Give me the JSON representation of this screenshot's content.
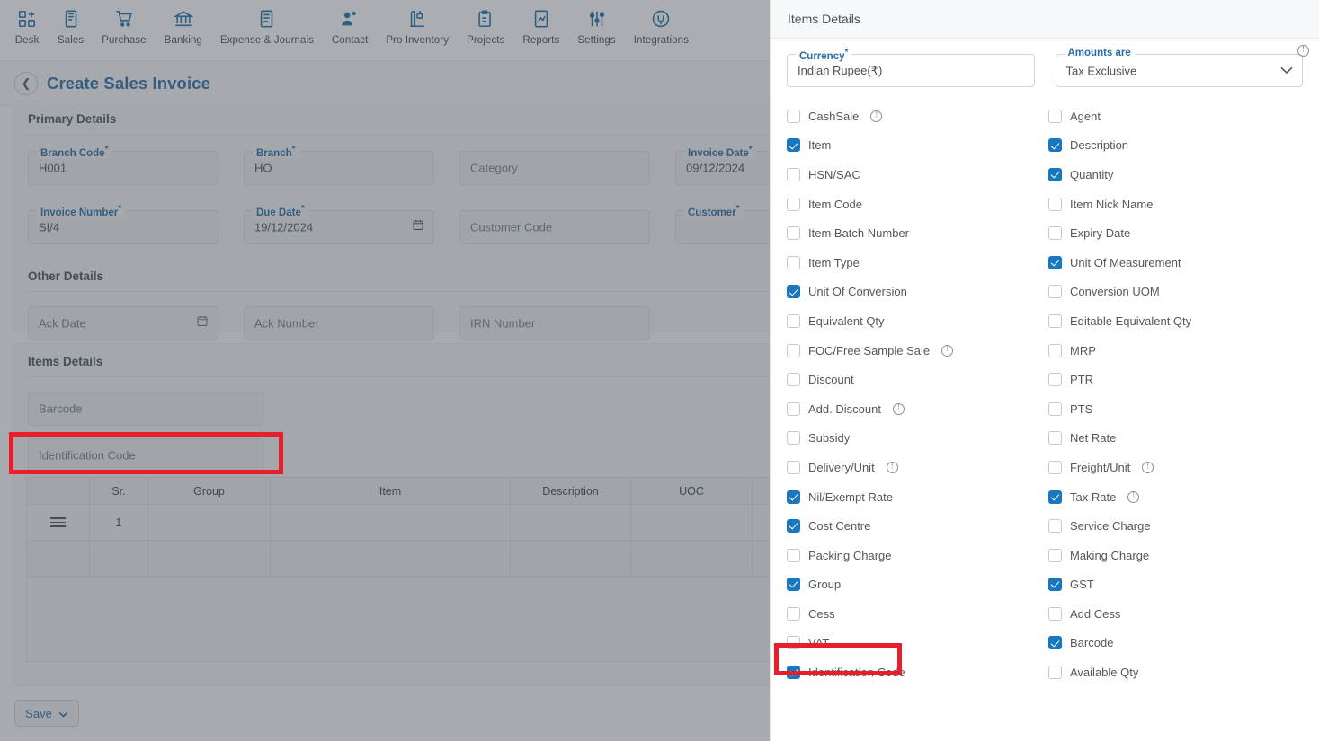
{
  "topnav": [
    {
      "label": "Desk",
      "icon": "desk-icon"
    },
    {
      "label": "Sales",
      "icon": "sales-icon"
    },
    {
      "label": "Purchase",
      "icon": "purchase-cart-icon"
    },
    {
      "label": "Banking",
      "icon": "bank-icon"
    },
    {
      "label": "Expense & Journals",
      "icon": "journal-icon"
    },
    {
      "label": "Contact",
      "icon": "contact-people-icon"
    },
    {
      "label": "Pro Inventory",
      "icon": "inventory-icon"
    },
    {
      "label": "Projects",
      "icon": "projects-clipboard-icon"
    },
    {
      "label": "Reports",
      "icon": "reports-chart-icon"
    },
    {
      "label": "Settings",
      "icon": "settings-sliders-icon"
    },
    {
      "label": "Integrations",
      "icon": "integrations-plug-icon"
    }
  ],
  "header": {
    "back_icon": "chevron-left-icon",
    "title": "Create Sales Invoice"
  },
  "primary_details": {
    "title": "Primary Details",
    "fields": [
      {
        "legend": "Branch Code",
        "required": true,
        "value": "H001",
        "placeholder": ""
      },
      {
        "legend": "Branch",
        "required": true,
        "value": "HO",
        "placeholder": ""
      },
      {
        "legend": "",
        "required": false,
        "value": "",
        "placeholder": "Category"
      },
      {
        "legend": "Invoice Date",
        "required": true,
        "value": "09/12/2024",
        "placeholder": ""
      },
      {
        "legend": "Invoice Number",
        "required": true,
        "value": "SI/4",
        "placeholder": ""
      },
      {
        "legend": "Due Date",
        "required": true,
        "value": "19/12/2024",
        "placeholder": "",
        "calendar": true
      },
      {
        "legend": "",
        "required": false,
        "value": "",
        "placeholder": "Customer Code"
      },
      {
        "legend": "Customer",
        "required": true,
        "value": "",
        "placeholder": ""
      }
    ]
  },
  "other_details": {
    "title": "Other Details",
    "fields": [
      {
        "legend": "",
        "value": "",
        "placeholder": "Ack Date",
        "calendar": true
      },
      {
        "legend": "",
        "value": "",
        "placeholder": "Ack Number"
      },
      {
        "legend": "",
        "value": "",
        "placeholder": "IRN Number"
      }
    ]
  },
  "items_details_card": {
    "title": "Items Details",
    "expand_icon": "chevron-right-icon",
    "fields": [
      {
        "placeholder": "Barcode"
      },
      {
        "placeholder": "Identification Code"
      }
    ],
    "grid": {
      "columns": [
        "",
        "Sr.",
        "Group",
        "Item",
        "Description",
        "UOC"
      ],
      "rows": [
        {
          "handle": "drag-handle-icon",
          "sr": "1",
          "group": "",
          "item": "",
          "description": "",
          "uoc": ""
        }
      ]
    }
  },
  "footer": {
    "save_label": "Save",
    "save_caret_icon": "chevron-down-icon"
  },
  "panel": {
    "title": "Items Details",
    "currency": {
      "legend": "Currency",
      "required": true,
      "value": "Indian Rupee(₹)"
    },
    "amounts_are": {
      "legend": "Amounts are",
      "required": false,
      "value": "Tax Exclusive",
      "caret_icon": "chevron-down-icon",
      "info_icon": "info-icon"
    },
    "options": [
      {
        "label": "CashSale",
        "checked": false,
        "info": true,
        "col": "left"
      },
      {
        "label": "Agent",
        "checked": false,
        "info": false,
        "col": "right"
      },
      {
        "label": "Item",
        "checked": true,
        "info": false,
        "col": "left"
      },
      {
        "label": "Description",
        "checked": true,
        "info": false,
        "col": "right"
      },
      {
        "label": "HSN/SAC",
        "checked": false,
        "info": false,
        "col": "left"
      },
      {
        "label": "Quantity",
        "checked": true,
        "info": false,
        "col": "right"
      },
      {
        "label": "Item Code",
        "checked": false,
        "info": false,
        "col": "left"
      },
      {
        "label": "Item Nick Name",
        "checked": false,
        "info": false,
        "col": "right"
      },
      {
        "label": "Item Batch Number",
        "checked": false,
        "info": false,
        "col": "left"
      },
      {
        "label": "Expiry Date",
        "checked": false,
        "info": false,
        "col": "right"
      },
      {
        "label": "Item Type",
        "checked": false,
        "info": false,
        "col": "left"
      },
      {
        "label": "Unit Of Measurement",
        "checked": true,
        "info": false,
        "col": "right"
      },
      {
        "label": "Unit Of Conversion",
        "checked": true,
        "info": false,
        "col": "left"
      },
      {
        "label": "Conversion UOM",
        "checked": false,
        "info": false,
        "col": "right"
      },
      {
        "label": "Equivalent Qty",
        "checked": false,
        "info": false,
        "col": "left"
      },
      {
        "label": "Editable Equivalent Qty",
        "checked": false,
        "info": false,
        "col": "right"
      },
      {
        "label": "FOC/Free Sample Sale",
        "checked": false,
        "info": true,
        "col": "left"
      },
      {
        "label": "MRP",
        "checked": false,
        "info": false,
        "col": "right"
      },
      {
        "label": "Discount",
        "checked": false,
        "info": false,
        "col": "left"
      },
      {
        "label": "PTR",
        "checked": false,
        "info": false,
        "col": "right"
      },
      {
        "label": "Add. Discount",
        "checked": false,
        "info": true,
        "col": "left"
      },
      {
        "label": "PTS",
        "checked": false,
        "info": false,
        "col": "right"
      },
      {
        "label": "Subsidy",
        "checked": false,
        "info": false,
        "col": "left"
      },
      {
        "label": "Net Rate",
        "checked": false,
        "info": false,
        "col": "right"
      },
      {
        "label": "Delivery/Unit",
        "checked": false,
        "info": true,
        "col": "left"
      },
      {
        "label": "Freight/Unit",
        "checked": false,
        "info": true,
        "col": "right"
      },
      {
        "label": "Nil/Exempt Rate",
        "checked": true,
        "info": false,
        "col": "left"
      },
      {
        "label": "Tax Rate",
        "checked": true,
        "info": true,
        "col": "right"
      },
      {
        "label": "Cost Centre",
        "checked": true,
        "info": false,
        "col": "left"
      },
      {
        "label": "Service Charge",
        "checked": false,
        "info": false,
        "col": "right"
      },
      {
        "label": "Packing Charge",
        "checked": false,
        "info": false,
        "col": "left"
      },
      {
        "label": "Making Charge",
        "checked": false,
        "info": false,
        "col": "right"
      },
      {
        "label": "Group",
        "checked": true,
        "info": false,
        "col": "left"
      },
      {
        "label": "GST",
        "checked": true,
        "info": false,
        "col": "right"
      },
      {
        "label": "Cess",
        "checked": false,
        "info": false,
        "col": "left"
      },
      {
        "label": "Add Cess",
        "checked": false,
        "info": false,
        "col": "right"
      },
      {
        "label": "VAT",
        "checked": false,
        "info": false,
        "col": "left"
      },
      {
        "label": "Barcode",
        "checked": true,
        "info": false,
        "col": "right"
      },
      {
        "label": "Identification Code",
        "checked": true,
        "info": false,
        "col": "left"
      },
      {
        "label": "Available Qty",
        "checked": false,
        "info": false,
        "col": "right"
      }
    ]
  },
  "colors": {
    "accent_blue": "#2b6ca3",
    "checkbox_blue": "#1877bf",
    "highlight_red": "#e81f2a",
    "panel_bg": "#ffffff",
    "app_bg": "#eef0f2"
  }
}
